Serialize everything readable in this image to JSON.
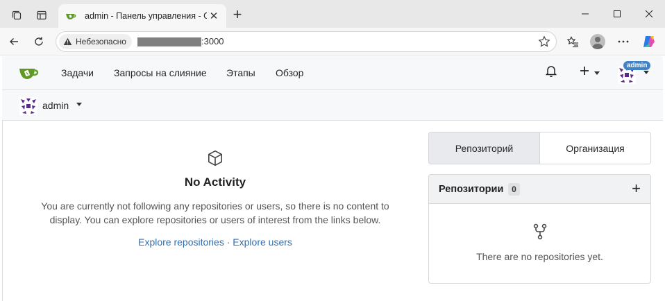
{
  "browser": {
    "tab_title": "admin - Панель управления - Gi",
    "security_label": "Небезопасно",
    "url_suffix": ":3000"
  },
  "nav": {
    "items": [
      {
        "label": "Задачи"
      },
      {
        "label": "Запросы на слияние"
      },
      {
        "label": "Этапы"
      },
      {
        "label": "Обзор"
      }
    ],
    "admin_badge": "admin"
  },
  "context": {
    "name": "admin"
  },
  "feed": {
    "title": "No Activity",
    "description": "You are currently not following any repositories or users, so there is no content to display. You can explore repositories or users of interest from the links below.",
    "explore_repos": "Explore repositories",
    "separator": "·",
    "explore_users": "Explore users"
  },
  "sidebar": {
    "switch": [
      {
        "label": "Репозиторий",
        "active": true
      },
      {
        "label": "Организация",
        "active": false
      }
    ],
    "repos_title": "Репозитории",
    "repos_count": "0",
    "empty_text": "There are no repositories yet."
  },
  "colors": {
    "link": "#2e6eb5",
    "badge": "#4183c4",
    "gitea_green": "#609926",
    "avatar_purple": "#5b2a86"
  },
  "icons": [
    "tab-actions-icon",
    "sidebar-toggle-icon",
    "gitea-favicon",
    "close-icon",
    "plus-icon",
    "minimize-icon",
    "maximize-icon",
    "back-icon",
    "reload-icon",
    "warning-icon",
    "star-icon",
    "favorites-icon",
    "more-icon",
    "copilot-icon",
    "bell-icon",
    "package-icon",
    "repo-fork-icon"
  ]
}
